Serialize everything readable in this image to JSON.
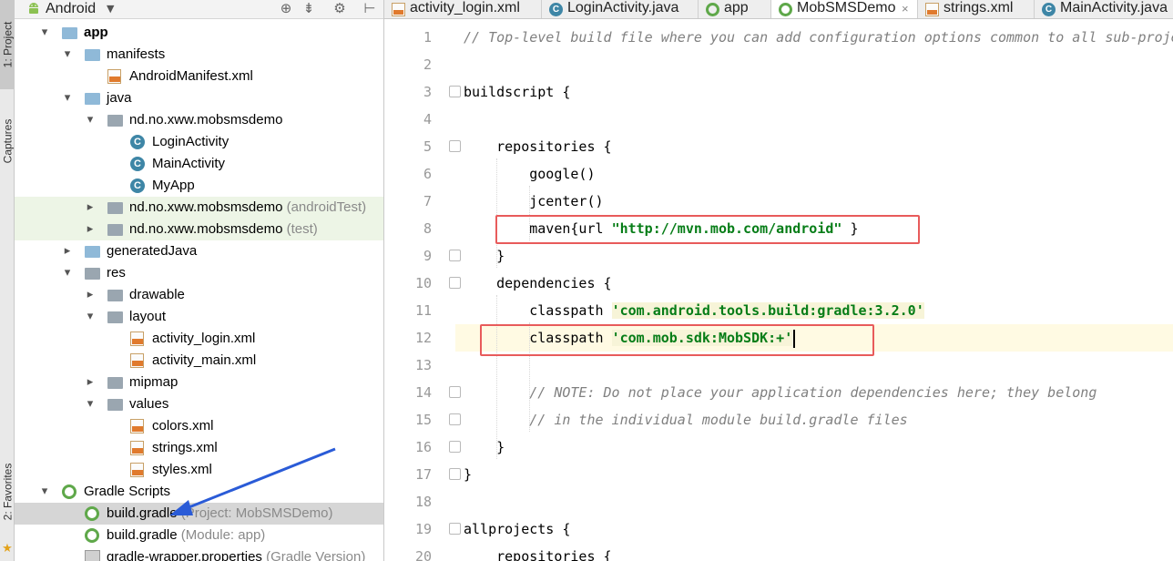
{
  "sidestrip": {
    "tabs": [
      {
        "label": "1: Project"
      },
      {
        "label": "Captures"
      },
      {
        "label": "2: Favorites"
      }
    ]
  },
  "project_panel": {
    "view_label": "Android",
    "tree": [
      {
        "label": "app",
        "arrow": "▾",
        "icon": "folder",
        "bold": true,
        "hint": ""
      },
      {
        "label": "manifests",
        "arrow": "▾",
        "icon": "folder",
        "hint": ""
      },
      {
        "label": "AndroidManifest.xml",
        "arrow": "",
        "icon": "manifest",
        "hint": ""
      },
      {
        "label": "java",
        "arrow": "▾",
        "icon": "folder",
        "hint": ""
      },
      {
        "label": "nd.no.xww.mobsmsdemo",
        "arrow": "▾",
        "icon": "package",
        "hint": ""
      },
      {
        "label": "LoginActivity",
        "arrow": "",
        "icon": "class",
        "hint": ""
      },
      {
        "label": "MainActivity",
        "arrow": "",
        "icon": "class",
        "hint": ""
      },
      {
        "label": "MyApp",
        "arrow": "",
        "icon": "class",
        "hint": ""
      },
      {
        "label": "nd.no.xww.mobsmsdemo",
        "arrow": "▸",
        "icon": "package",
        "hint": "(androidTest)"
      },
      {
        "label": "nd.no.xww.mobsmsdemo",
        "arrow": "▸",
        "icon": "package",
        "hint": "(test)"
      },
      {
        "label": "generatedJava",
        "arrow": "▸",
        "icon": "folder",
        "hint": ""
      },
      {
        "label": "res",
        "arrow": "▾",
        "icon": "res-folder",
        "hint": ""
      },
      {
        "label": "drawable",
        "arrow": "▸",
        "icon": "package",
        "hint": ""
      },
      {
        "label": "layout",
        "arrow": "▾",
        "icon": "package",
        "hint": ""
      },
      {
        "label": "activity_login.xml",
        "arrow": "",
        "icon": "xml",
        "hint": ""
      },
      {
        "label": "activity_main.xml",
        "arrow": "",
        "icon": "xml",
        "hint": ""
      },
      {
        "label": "mipmap",
        "arrow": "▸",
        "icon": "package",
        "hint": ""
      },
      {
        "label": "values",
        "arrow": "▾",
        "icon": "package",
        "hint": ""
      },
      {
        "label": "colors.xml",
        "arrow": "",
        "icon": "xml",
        "hint": ""
      },
      {
        "label": "strings.xml",
        "arrow": "",
        "icon": "xml",
        "hint": ""
      },
      {
        "label": "styles.xml",
        "arrow": "",
        "icon": "xml",
        "hint": ""
      },
      {
        "label": "Gradle Scripts",
        "arrow": "▾",
        "icon": "gradle",
        "hint": ""
      },
      {
        "label": "build.gradle",
        "arrow": "",
        "icon": "gradle",
        "hint": "(Project: MobSMSDemo)"
      },
      {
        "label": "build.gradle",
        "arrow": "",
        "icon": "gradle",
        "hint": "(Module: app)"
      },
      {
        "label": "gradle-wrapper.properties",
        "arrow": "",
        "icon": "properties",
        "hint": "(Gradle Version)"
      }
    ]
  },
  "tabs": [
    {
      "label": "activity_login.xml",
      "icon": "xml",
      "close": ""
    },
    {
      "label": "LoginActivity.java",
      "icon": "class",
      "close": ""
    },
    {
      "label": "app",
      "icon": "gradle",
      "close": ""
    },
    {
      "label": "MobSMSDemo",
      "icon": "gradle",
      "close": "×"
    },
    {
      "label": "strings.xml",
      "icon": "xml",
      "close": ""
    },
    {
      "label": "MainActivity.java",
      "icon": "class",
      "close": ""
    }
  ],
  "editor": {
    "line_numbers": [
      "1",
      "2",
      "3",
      "4",
      "5",
      "6",
      "7",
      "8",
      "9",
      "10",
      "11",
      "12",
      "13",
      "14",
      "15",
      "16",
      "17",
      "18",
      "19",
      "20"
    ],
    "lines": [
      {
        "pre": "// Top-level build file where you can add configuration options common to all sub-projects/modules.",
        "str": "",
        "post": "",
        "comment": true
      },
      {
        "pre": "",
        "str": "",
        "post": ""
      },
      {
        "pre": "buildscript {",
        "str": "",
        "post": ""
      },
      {
        "pre": "",
        "str": "",
        "post": ""
      },
      {
        "pre": "    repositories {",
        "str": "",
        "post": ""
      },
      {
        "pre": "        google()",
        "str": "",
        "post": ""
      },
      {
        "pre": "        jcenter()",
        "str": "",
        "post": ""
      },
      {
        "pre": "        maven{url ",
        "str": "\"http://mvn.mob.com/android\"",
        "post": " }"
      },
      {
        "pre": "    }",
        "str": "",
        "post": ""
      },
      {
        "pre": "    dependencies {",
        "str": "",
        "post": ""
      },
      {
        "pre": "        classpath ",
        "str": "'com.android.tools.build:gradle:3.2.0'",
        "post": ""
      },
      {
        "pre": "        classpath ",
        "str": "'com.mob.sdk:MobSDK:+'",
        "post": ""
      },
      {
        "pre": "",
        "str": "",
        "post": ""
      },
      {
        "pre": "        // NOTE: Do not place your application dependencies here; they belong",
        "str": "",
        "post": "",
        "comment": true
      },
      {
        "pre": "        // in the individual module build.gradle files",
        "str": "",
        "post": "",
        "comment": true
      },
      {
        "pre": "    }",
        "str": "",
        "post": ""
      },
      {
        "pre": "}",
        "str": "",
        "post": ""
      },
      {
        "pre": "",
        "str": "",
        "post": ""
      },
      {
        "pre": "allprojects {",
        "str": "",
        "post": ""
      },
      {
        "pre": "    repositories {",
        "str": "",
        "post": ""
      }
    ]
  },
  "colors": {
    "annotation_red": "#e85b5b",
    "annotation_arrow": "#2a5bd7",
    "string_green": "#067d17",
    "comment_gray": "#808080",
    "caret_line": "#fffae3",
    "gradle_green": "#5fa84a"
  }
}
